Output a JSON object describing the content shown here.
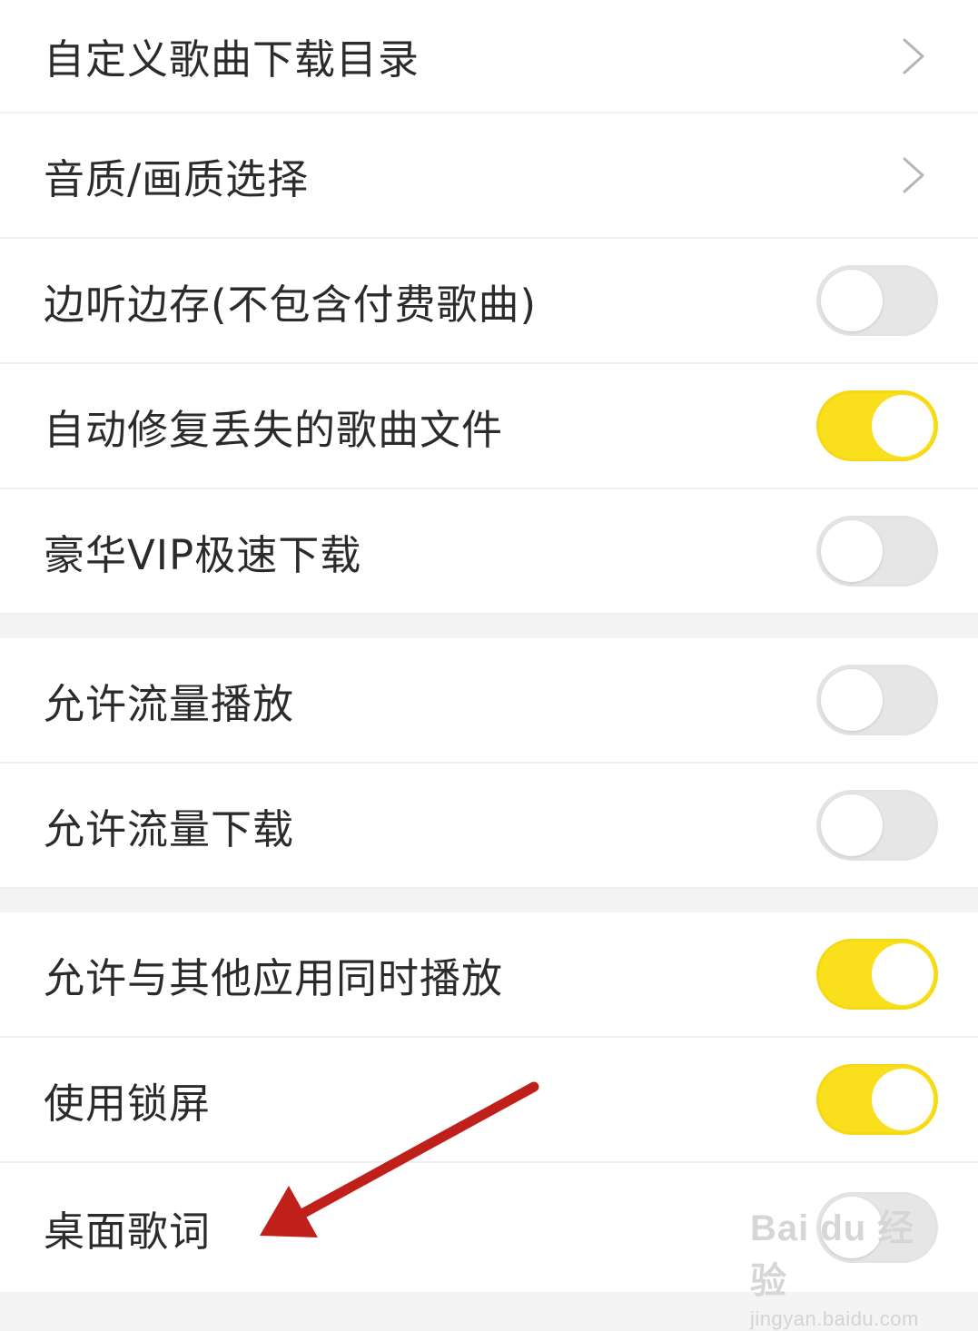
{
  "settings": {
    "rows": [
      {
        "label": "自定义歌曲下载目录",
        "control": "chevron"
      },
      {
        "label": "音质/画质选择",
        "control": "chevron"
      },
      {
        "label": "边听边存(不包含付费歌曲)",
        "control": "toggle",
        "state": "off"
      },
      {
        "label": "自动修复丢失的歌曲文件",
        "control": "toggle",
        "state": "on"
      },
      {
        "label": "豪华VIP极速下载",
        "control": "toggle",
        "state": "off"
      },
      {
        "label": "允许流量播放",
        "control": "toggle",
        "state": "off"
      },
      {
        "label": "允许流量下载",
        "control": "toggle",
        "state": "off"
      },
      {
        "label": "允许与其他应用同时播放",
        "control": "toggle",
        "state": "on"
      },
      {
        "label": "使用锁屏",
        "control": "toggle",
        "state": "on"
      },
      {
        "label": "桌面歌词",
        "control": "toggle",
        "state": "off"
      }
    ]
  },
  "icons": {
    "chevron": "chevron-right-icon",
    "annotation": "red-arrow-icon"
  },
  "colors": {
    "toggle_on": "#f9df1c",
    "toggle_off": "#e6e6e6",
    "arrow": "#c0201a"
  },
  "watermark": {
    "brand": "Bai du 经验",
    "url": "jingyan.baidu.com"
  }
}
